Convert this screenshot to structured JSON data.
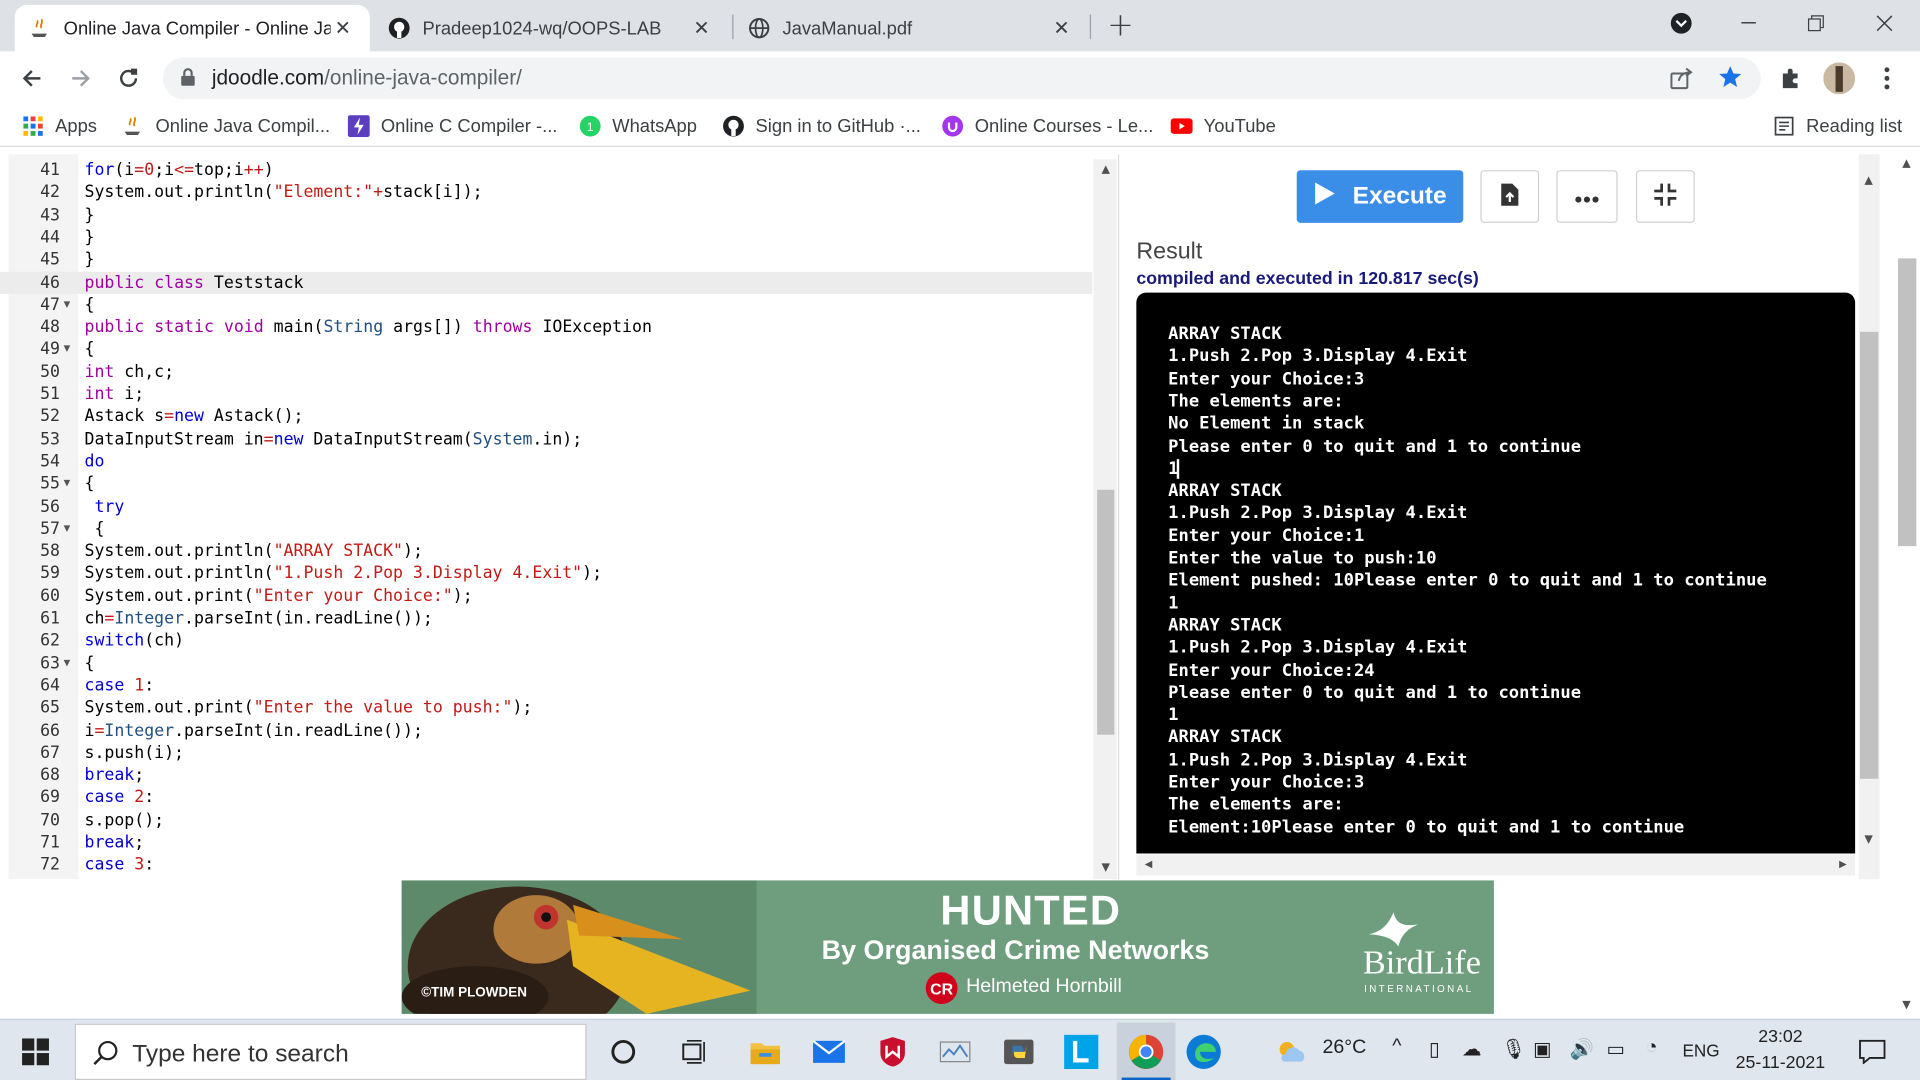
{
  "browser": {
    "tabs": [
      {
        "title": "Online Java Compiler - Online Ja",
        "active": true
      },
      {
        "title": "Pradeep1024-wq/OOPS-LAB",
        "active": false
      },
      {
        "title": "JavaManual.pdf",
        "active": false
      }
    ],
    "new_tab_label": "+",
    "url_host": "jdoodle.com",
    "url_path": "/online-java-compiler/",
    "bookmarks": [
      "Apps",
      "Online Java Compil...",
      "Online C Compiler -...",
      "WhatsApp",
      "Sign in to GitHub ·...",
      "Online Courses - Le...",
      "YouTube"
    ],
    "reading_list": "Reading list"
  },
  "editor": {
    "lines": [
      {
        "n": "41",
        "h": "<span class='kb'>for</span>(i<span class='op'>=</span><span class='str'>0</span>;i<span class='op'>&lt;=</span>top;i<span class='op'>++</span>)"
      },
      {
        "n": "42",
        "h": "System.out.println(<span class='str'>\"Element:\"</span><span class='op'>+</span>stack[i]);"
      },
      {
        "n": "43",
        "h": "}"
      },
      {
        "n": "44",
        "h": "}"
      },
      {
        "n": "45",
        "h": "}"
      },
      {
        "n": "46",
        "h": "<span class='kw'>public</span> <span class='kw'>class</span> Teststack",
        "cur": true
      },
      {
        "n": "47",
        "h": "{",
        "fold": true
      },
      {
        "n": "48",
        "h": "<span class='kw'>public</span> <span class='kw'>static</span> <span class='kw'>void</span> main(<span class='cls'>String</span> args[]) <span class='kw'>throws</span> IOException"
      },
      {
        "n": "49",
        "h": "{",
        "fold": true
      },
      {
        "n": "50",
        "h": "<span class='kw'>int</span> ch,c;"
      },
      {
        "n": "51",
        "h": "<span class='kw'>int</span> i;"
      },
      {
        "n": "52",
        "h": "Astack s<span class='op'>=</span><span class='kb'>new</span> Astack();"
      },
      {
        "n": "53",
        "h": "DataInputStream in<span class='op'>=</span><span class='kb'>new</span> DataInputStream(<span class='cls'>System</span>.in);"
      },
      {
        "n": "54",
        "h": "<span class='kb'>do</span>"
      },
      {
        "n": "55",
        "h": "{",
        "fold": true
      },
      {
        "n": "56",
        "h": " <span class='kb'>try</span>"
      },
      {
        "n": "57",
        "h": " {",
        "fold": true
      },
      {
        "n": "58",
        "h": "System.out.println(<span class='str'>\"ARRAY STACK\"</span>);"
      },
      {
        "n": "59",
        "h": "System.out.println(<span class='str'>\"1.Push 2.Pop 3.Display 4.Exit\"</span>);"
      },
      {
        "n": "60",
        "h": "System.out.print(<span class='str'>\"Enter your Choice:\"</span>);"
      },
      {
        "n": "61",
        "h": "ch<span class='op'>=</span><span class='cls'>Integer</span>.parseInt(in.readLine());"
      },
      {
        "n": "62",
        "h": "<span class='kb'>switch</span>(ch)"
      },
      {
        "n": "63",
        "h": "{",
        "fold": true
      },
      {
        "n": "64",
        "h": "<span class='kb'>case</span> <span class='str'>1</span>:"
      },
      {
        "n": "65",
        "h": "System.out.print(<span class='str'>\"Enter the value to push:\"</span>);"
      },
      {
        "n": "66",
        "h": "i<span class='op'>=</span><span class='cls'>Integer</span>.parseInt(in.readLine());"
      },
      {
        "n": "67",
        "h": "s.push(i);"
      },
      {
        "n": "68",
        "h": "<span class='kb'>break</span>;"
      },
      {
        "n": "69",
        "h": "<span class='kb'>case</span> <span class='str'>2</span>:"
      },
      {
        "n": "70",
        "h": "s.pop();"
      },
      {
        "n": "71",
        "h": "<span class='kb'>break</span>;"
      },
      {
        "n": "72",
        "h": "<span class='kb'>case</span> <span class='str'>3</span>:"
      }
    ]
  },
  "runner": {
    "execute_label": "Execute",
    "result_title": "Result",
    "status": "compiled and executed in 120.817 sec(s)",
    "output": [
      "ARRAY STACK",
      "1.Push 2.Pop 3.Display 4.Exit",
      "Enter your Choice:3",
      "The elements are:",
      "No Element in stack",
      "Please enter 0 to quit and 1 to continue",
      "1",
      "ARRAY STACK",
      "1.Push 2.Pop 3.Display 4.Exit",
      "Enter your Choice:1",
      "Enter the value to push:10",
      "Element pushed: 10Please enter 0 to quit and 1 to continue",
      "1",
      "ARRAY STACK",
      "1.Push 2.Pop 3.Display 4.Exit",
      "Enter your Choice:24",
      "Please enter 0 to quit and 1 to continue",
      "1",
      "ARRAY STACK",
      "1.Push 2.Pop 3.Display 4.Exit",
      "Enter your Choice:3",
      "The elements are:",
      "Element:10Please enter 0 to quit and 1 to continue"
    ]
  },
  "ad": {
    "headline": "HUNTED",
    "subline": "By Organised Crime Networks",
    "badge": "CR",
    "species": "Helmeted Hornbill",
    "credit": "©TIM PLOWDEN",
    "brand": "BirdLife",
    "brand_sub": "INTERNATIONAL"
  },
  "taskbar": {
    "search_placeholder": "Type here to search",
    "temperature": "26°C",
    "language": "ENG",
    "time": "23:02",
    "date": "25-11-2021"
  }
}
